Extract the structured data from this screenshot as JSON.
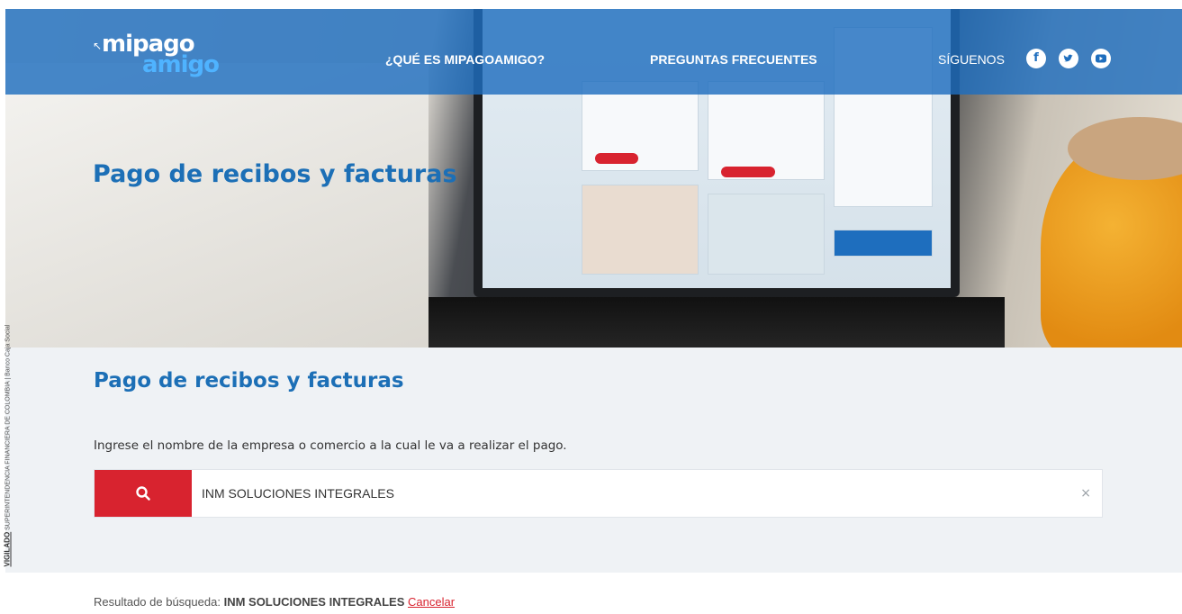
{
  "header": {
    "logo_line1": "mipago",
    "logo_line2": "amigo",
    "nav": [
      {
        "label": "¿QUÉ ES MIPAGOAMIGO?"
      },
      {
        "label": "PREGUNTAS FRECUENTES"
      }
    ],
    "social_label": "SÍGUENOS",
    "social_icons": [
      "facebook-icon",
      "twitter-icon",
      "youtube-icon"
    ]
  },
  "hero": {
    "title": "Pago de recibos y facturas"
  },
  "main": {
    "title": "Pago de recibos y facturas",
    "instructions": "Ingrese el nombre de la empresa o comercio a la cual le va a realizar el pago.",
    "search_value": "INM SOLUCIONES INTEGRALES",
    "clear_label": "×"
  },
  "sidebar_note": {
    "vigilado": "VIGILADO",
    "text": "SUPERINTENDENCIA FINANCIERA DE COLOMBIA | Banco Caja Social"
  },
  "results": {
    "prefix": "Resultado de búsqueda:",
    "query": "INM SOLUCIONES INTEGRALES",
    "cancel": "Cancelar"
  },
  "colors": {
    "brand_blue": "#1c6fb6",
    "nav_blue": "#1e6ebe",
    "accent_red": "#d8232f",
    "section_bg": "#eff2f5"
  }
}
